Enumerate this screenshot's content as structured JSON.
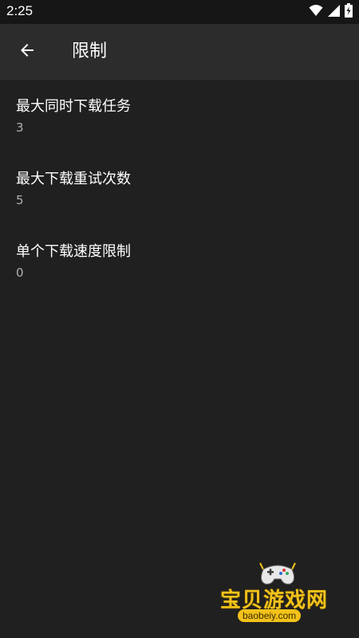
{
  "status_bar": {
    "time": "2:25",
    "icons": [
      "wifi-icon",
      "cell-signal-icon",
      "battery-charging-icon"
    ]
  },
  "toolbar": {
    "back_icon": "arrow-back-icon",
    "title": "限制"
  },
  "settings": [
    {
      "title": "最大同时下载任务",
      "value": "3"
    },
    {
      "title": "最大下载重试次数",
      "value": "5"
    },
    {
      "title": "单个下载速度限制",
      "value": "0"
    }
  ],
  "watermark": {
    "text": "宝贝游戏网",
    "url": "baobeiy.com",
    "icon": "gamepad-mascot-icon"
  },
  "colors": {
    "background": "#202020",
    "toolbar": "#2c2c2c",
    "status_bar": "#161616",
    "secondary_text": "#b0b0b0",
    "watermark": "#f3c21a"
  }
}
